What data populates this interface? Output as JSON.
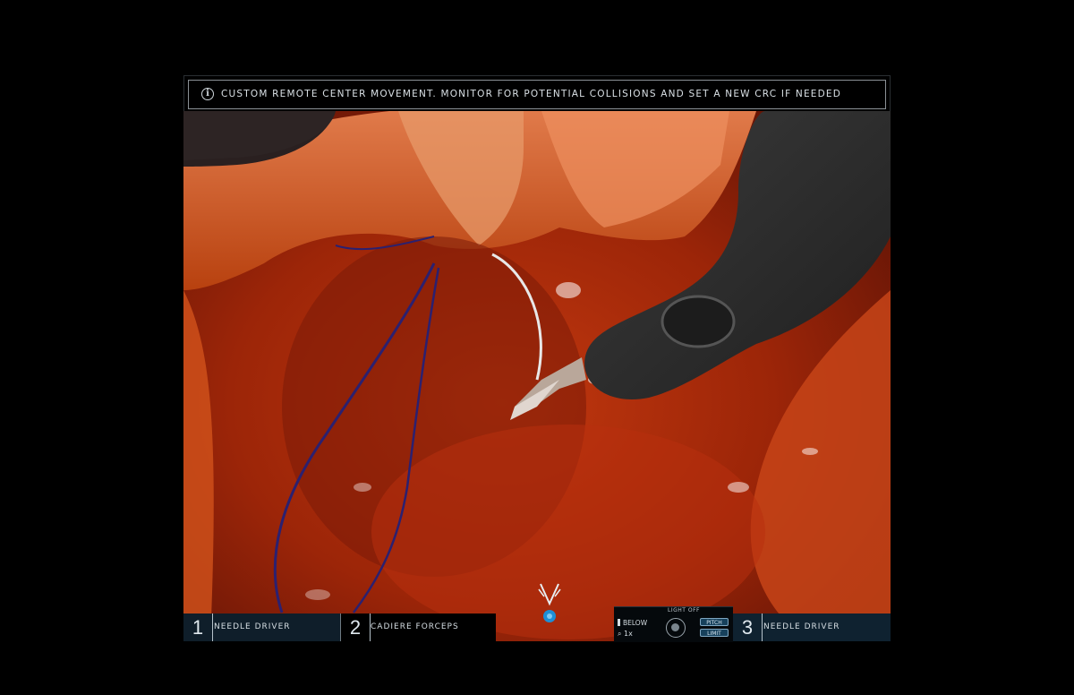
{
  "notification": {
    "icon": "info-icon",
    "message": "CUSTOM REMOTE CENTER MOVEMENT. MONITOR FOR POTENTIAL COLLISIONS AND SET A NEW CRC IF NEEDED"
  },
  "instruments": [
    {
      "number": "1",
      "name": "NEEDLE DRIVER"
    },
    {
      "number": "2",
      "name": "CADIERE FORCEPS"
    },
    {
      "number": "3",
      "name": "NEEDLE DRIVER"
    }
  ],
  "status_panel": {
    "top_label": "LIGHT OFF",
    "follow_label": "BELOW",
    "zoom_label": "1x",
    "badge_pitch": "PITCH",
    "badge_limit": "LIMIT"
  },
  "colors": {
    "tissue": "#b8300f",
    "instrument": "#2e2e2e",
    "suture": "#2b2070",
    "panel_accent": "#17415c"
  }
}
